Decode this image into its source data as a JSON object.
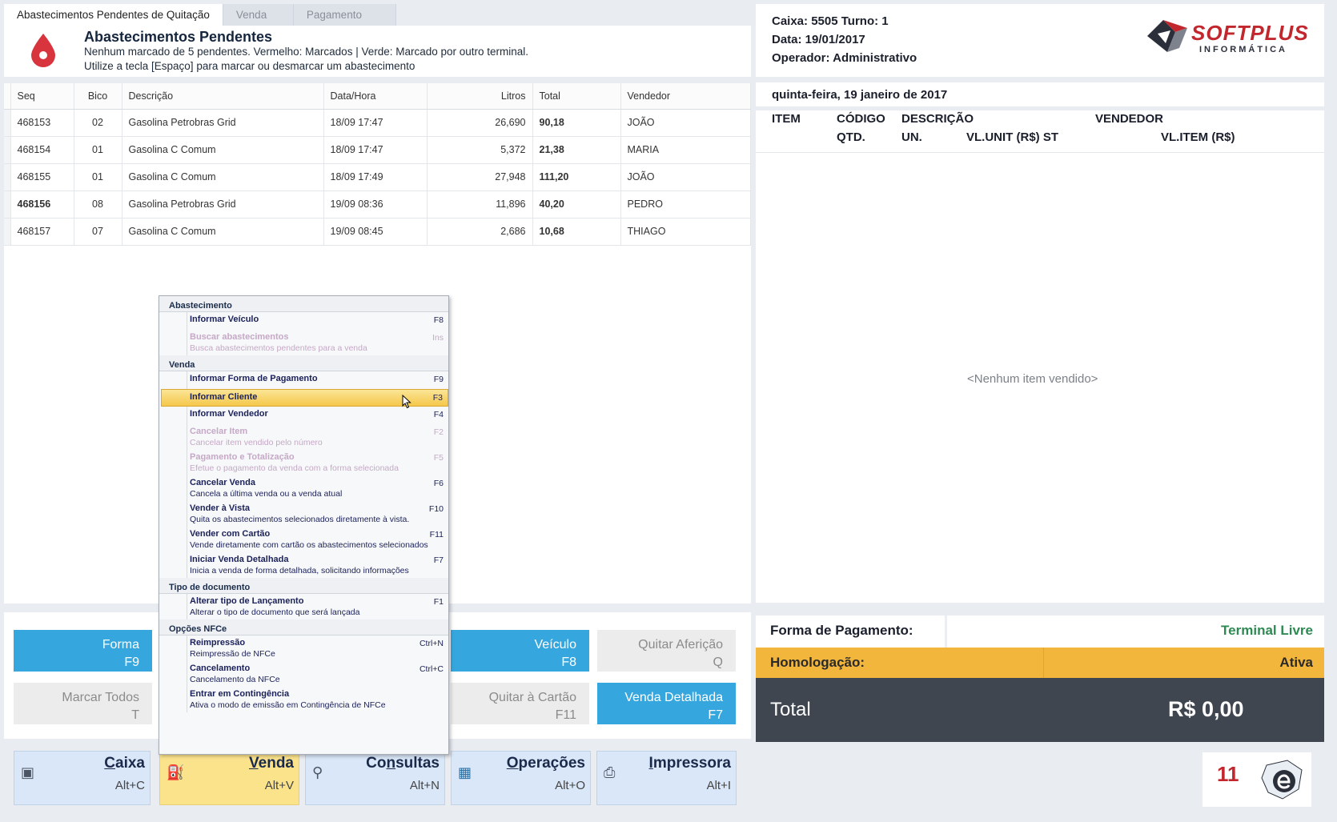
{
  "tabs": [
    {
      "label": "Abastecimentos Pendentes de Quitação"
    },
    {
      "label": "Venda"
    },
    {
      "label": "Pagamento"
    }
  ],
  "header": {
    "title": "Abastecimentos Pendentes",
    "line1": "Nenhum marcado de 5 pendentes. Vermelho: Marcados | Verde: Marcado por outro terminal.",
    "line2": "Utilize a tecla [Espaço] para marcar ou desmarcar um abastecimento"
  },
  "grid": {
    "columns": [
      "Seq",
      "Bico",
      "Descrição",
      "Data/Hora",
      "Litros",
      "Total",
      "Vendedor"
    ],
    "rows": [
      {
        "seq": "468153",
        "bico": "02",
        "desc": "Gasolina Petrobras Grid",
        "data": "18/09 17:47",
        "litros": "26,690",
        "total": "90,18",
        "vendedor": "JOÃO"
      },
      {
        "seq": "468154",
        "bico": "01",
        "desc": "Gasolina C Comum",
        "data": "18/09 17:47",
        "litros": "5,372",
        "total": "21,38",
        "vendedor": "MARIA"
      },
      {
        "seq": "468155",
        "bico": "01",
        "desc": "Gasolina C Comum",
        "data": "18/09 17:49",
        "litros": "27,948",
        "total": "111,20",
        "vendedor": "JOÃO"
      },
      {
        "seq": "468156",
        "bico": "08",
        "desc": "Gasolina Petrobras Grid",
        "data": "19/09 08:36",
        "litros": "11,896",
        "total": "40,20",
        "vendedor": "PEDRO"
      },
      {
        "seq": "468157",
        "bico": "07",
        "desc": "Gasolina C Comum",
        "data": "19/09 08:45",
        "litros": "2,686",
        "total": "10,68",
        "vendedor": "THIAGO"
      }
    ]
  },
  "menu": {
    "sec_abastecimento": "Abastecimento",
    "informar_veiculo": {
      "t": "Informar Veículo",
      "k": "F8"
    },
    "buscar": {
      "t": "Buscar abastecimentos",
      "d": "Busca abastecimentos pendentes para a venda",
      "k": "Ins"
    },
    "sec_venda": "Venda",
    "forma_pag": {
      "t": "Informar Forma de Pagamento",
      "k": "F9"
    },
    "cliente": {
      "t": "Informar Cliente",
      "k": "F3"
    },
    "vendedor": {
      "t": "Informar Vendedor",
      "k": "F4"
    },
    "cancelar_item": {
      "t": "Cancelar Item",
      "d": "Cancelar item vendido pelo número",
      "k": "F2"
    },
    "pagamento_tot": {
      "t": "Pagamento e Totalização",
      "d": "Efetue o pagamento da venda com a forma selecionada",
      "k": "F5"
    },
    "cancelar_venda": {
      "t": "Cancelar Venda",
      "d": "Cancela a última venda ou a venda atual",
      "k": "F6"
    },
    "vender_vista": {
      "t": "Vender à Vista",
      "d": "Quita os abastecimentos selecionados diretamente à vista.",
      "k": "F10"
    },
    "vender_cartao": {
      "t": "Vender com Cartão",
      "d": "Vende diretamente com cartão os abastecimentos selecionados",
      "k": "F11"
    },
    "venda_detalhada": {
      "t": "Iniciar Venda Detalhada",
      "d": "Inicia a venda de forma detalhada, solicitando informações",
      "k": "F7"
    },
    "sec_tipo": "Tipo de documento",
    "alterar_tipo": {
      "t": "Alterar tipo de Lançamento",
      "d": "Alterar o tipo de documento que será lançada",
      "k": "F1"
    },
    "sec_nfce": "Opções NFCe",
    "reimpressao": {
      "t": "Reimpressão",
      "d": "Reimpressão de NFCe",
      "k": "Ctrl+N"
    },
    "cancelamento": {
      "t": "Cancelamento",
      "d": "Cancelamento da NFCe",
      "k": "Ctrl+C"
    },
    "contingencia": {
      "t": "Entrar em Contingência",
      "d": "Ativa o modo de emissão em Contingência de NFCe"
    }
  },
  "actions": {
    "forma": {
      "label": "Forma",
      "key": "F9"
    },
    "veiculo": {
      "label": "Veículo",
      "key": "F8"
    },
    "quitar_afericao": {
      "label": "Quitar Aferição",
      "key": "Q"
    },
    "marcar_todos": {
      "label": "Marcar Todos",
      "key": "T"
    },
    "quitar_cartao": {
      "label": "Quitar à Cartão",
      "key": "F11"
    },
    "venda_detalhada": {
      "label": "Venda Detalhada",
      "key": "F7"
    }
  },
  "nav": [
    {
      "label": "Caixa",
      "key": "Alt+C"
    },
    {
      "label": "Venda",
      "key": "Alt+V"
    },
    {
      "label": "Consultas",
      "key": "Alt+N"
    },
    {
      "label": "Operações",
      "key": "Alt+O"
    },
    {
      "label": "Impressora",
      "key": "Alt+I"
    }
  ],
  "right": {
    "caixa": "Caixa: 5505 Turno: 1",
    "data": "Data: 19/01/2017",
    "operador": "Operador: Administrativo",
    "logo_top": "SOFTPLUS",
    "logo_bottom": "INFORMÁTICA",
    "date_long": "quinta-feira, 19 janeiro de 2017",
    "cols": {
      "item": "ITEM",
      "codigo": "CÓDIGO",
      "descricao": "DESCRIÇÃO",
      "vendedor": "VENDEDOR",
      "qtd": "QTD.",
      "un": "UN.",
      "vlunit": "VL.UNIT (R$) ST",
      "vlitem": "VL.ITEM (R$)"
    },
    "empty": "<Nenhum item vendido>",
    "forma_pagamento": "Forma de Pagamento:",
    "terminal_status": "Terminal Livre",
    "homologacao": "Homologação:",
    "homologacao_status": "Ativa",
    "total_label": "Total",
    "total_value": "R$ 0,00",
    "nfce_number": "11"
  },
  "colors": {
    "accent_blue": "#35a7de",
    "nav_selected": "#fbe38c",
    "homologacao": "#f3b63c",
    "total_bg": "#3f4650",
    "terminal_green": "#2e8a53",
    "drop_red": "#d8343e"
  }
}
